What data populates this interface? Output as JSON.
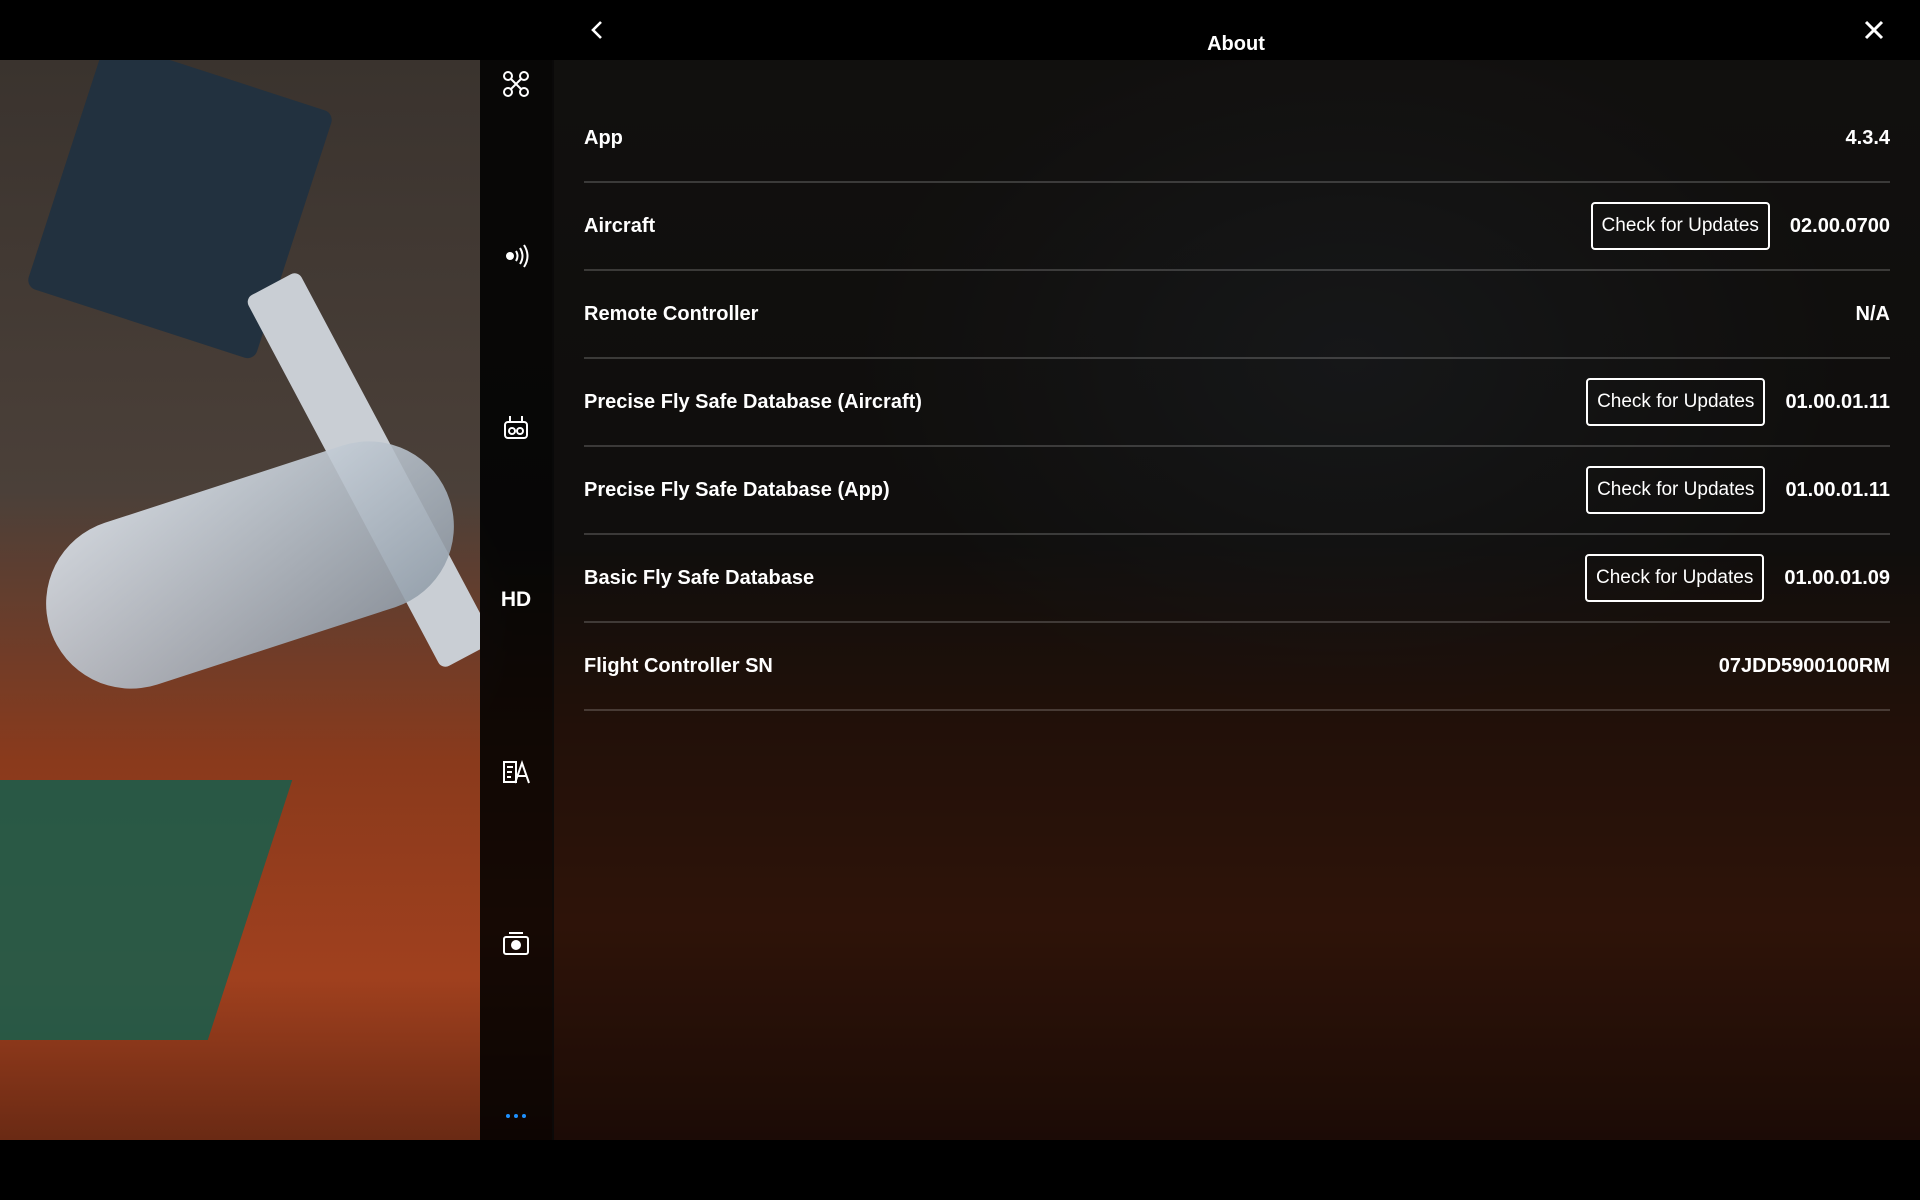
{
  "header": {
    "title": "About"
  },
  "rail": {
    "hd_label": "HD"
  },
  "rows": [
    {
      "label": "App",
      "value": "4.3.4",
      "button": null
    },
    {
      "label": "Aircraft",
      "value": "02.00.0700",
      "button": "Check for Updates"
    },
    {
      "label": "Remote Controller",
      "value": "N/A",
      "button": null
    },
    {
      "label": "Precise Fly Safe Database (Aircraft)",
      "value": "01.00.01.11",
      "button": "Check for Updates"
    },
    {
      "label": "Precise Fly Safe Database (App)",
      "value": "01.00.01.11",
      "button": "Check for Updates"
    },
    {
      "label": "Basic Fly Safe Database",
      "value": "01.00.01.09",
      "button": "Check for Updates"
    },
    {
      "label": "Flight Controller SN",
      "value": "07JDD5900100RM",
      "button": null
    }
  ],
  "icons": {
    "rail": [
      "aircraft-icon",
      "signal-icon",
      "remote-controller-icon",
      "hd-icon",
      "visual-navigation-icon",
      "camera-icon",
      "more-icon"
    ],
    "header": [
      "back-arrow-icon",
      "close-icon"
    ]
  },
  "colors": {
    "accent": "#1e90ff",
    "panel_bg": "rgba(0,0,0,0.62)"
  }
}
